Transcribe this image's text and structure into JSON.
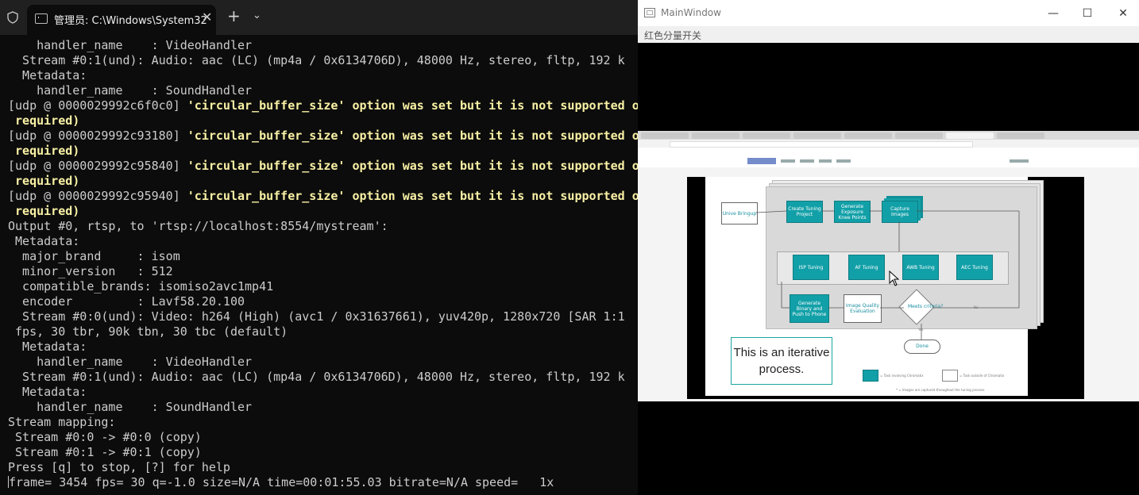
{
  "terminal": {
    "tab_title": "管理员: C:\\Windows\\System32",
    "close_glyph": "✕",
    "new_tab_glyph": "+",
    "dropdown_glyph": "⌄",
    "lines": [
      {
        "text": "    handler_name    : VideoHandler",
        "style": "normal"
      },
      {
        "text": "  Stream #0:1(und): Audio: aac (LC) (mp4a / 0x6134706D), 48000 Hz, stereo, fltp, 192 k",
        "style": "normal"
      },
      {
        "text": "  Metadata:",
        "style": "normal"
      },
      {
        "text": "    handler_name    : SoundHandler",
        "style": "normal"
      },
      {
        "prefix": "[udp @ 0000029992c6f0c0] ",
        "text": "'circular_buffer_size' option was set but it is not supported o",
        "style": "warn"
      },
      {
        "text": " required)",
        "style": "yellow"
      },
      {
        "prefix": "[udp @ 0000029992c93180] ",
        "text": "'circular_buffer_size' option was set but it is not supported o",
        "style": "warn"
      },
      {
        "text": " required)",
        "style": "yellow"
      },
      {
        "prefix": "[udp @ 0000029992c95840] ",
        "text": "'circular_buffer_size' option was set but it is not supported o",
        "style": "warn"
      },
      {
        "text": " required)",
        "style": "yellow"
      },
      {
        "prefix": "[udp @ 0000029992c95940] ",
        "text": "'circular_buffer_size' option was set but it is not supported o",
        "style": "warn"
      },
      {
        "text": " required)",
        "style": "yellow"
      },
      {
        "text": "Output #0, rtsp, to 'rtsp://localhost:8554/mystream':",
        "style": "normal"
      },
      {
        "text": " Metadata:",
        "style": "normal"
      },
      {
        "text": "  major_brand     : isom",
        "style": "normal"
      },
      {
        "text": "  minor_version   : 512",
        "style": "normal"
      },
      {
        "text": "  compatible_brands: isomiso2avc1mp41",
        "style": "normal"
      },
      {
        "text": "  encoder         : Lavf58.20.100",
        "style": "normal"
      },
      {
        "text": "  Stream #0:0(und): Video: h264 (High) (avc1 / 0x31637661), yuv420p, 1280x720 [SAR 1:1",
        "style": "normal"
      },
      {
        "text": " fps, 30 tbr, 90k tbn, 30 tbc (default)",
        "style": "normal"
      },
      {
        "text": "  Metadata:",
        "style": "normal"
      },
      {
        "text": "    handler_name    : VideoHandler",
        "style": "normal"
      },
      {
        "text": "  Stream #0:1(und): Audio: aac (LC) (mp4a / 0x6134706D), 48000 Hz, stereo, fltp, 192 k",
        "style": "normal"
      },
      {
        "text": "  Metadata:",
        "style": "normal"
      },
      {
        "text": "    handler_name    : SoundHandler",
        "style": "normal"
      },
      {
        "text": "Stream mapping:",
        "style": "normal"
      },
      {
        "text": " Stream #0:0 -> #0:0 (copy)",
        "style": "normal"
      },
      {
        "text": " Stream #0:1 -> #0:1 (copy)",
        "style": "normal"
      },
      {
        "text": "Press [q] to stop, [?] for help",
        "style": "normal"
      },
      {
        "text": "frame= 3454 fps= 30 q=-1.0 size=N/A time=00:01:55.03 bitrate=N/A speed=   1x",
        "style": "progress"
      }
    ]
  },
  "mainwindow": {
    "title": "MainWindow",
    "minimize_glyph": "—",
    "maximize_glyph": "☐",
    "close_glyph": "✕",
    "menu_item": "红色分量开关",
    "slide": {
      "boxes": [
        {
          "key": "unlive",
          "label": "Unive Bringup",
          "kind": "white"
        },
        {
          "key": "create",
          "label": "Create Tuning Project",
          "kind": "teal"
        },
        {
          "key": "generate",
          "label": "Generate Exposure Knee Points",
          "kind": "teal"
        },
        {
          "key": "capture",
          "label": "Capture Images",
          "kind": "teal"
        },
        {
          "key": "isp",
          "label": "ISP Tuning",
          "kind": "teal"
        },
        {
          "key": "af",
          "label": "AF Tuning",
          "kind": "teal"
        },
        {
          "key": "awb",
          "label": "AWB Tuning",
          "kind": "teal"
        },
        {
          "key": "aec",
          "label": "AEC Tuning",
          "kind": "teal"
        },
        {
          "key": "binary",
          "label": "Generate Binary and Push to Phone",
          "kind": "teal"
        },
        {
          "key": "iq",
          "label": "Image Quality Evaluation",
          "kind": "white"
        }
      ],
      "decision": "Meets criteria?",
      "no_label": "No",
      "yes_label": "Yes",
      "done": "Done",
      "note": "This is an iterative process.",
      "legend_teal": "= Task involving Chromatix",
      "legend_white": "= Task outside of Chromatix",
      "footnote": "* = Images are captured throughout the tuning process"
    }
  }
}
